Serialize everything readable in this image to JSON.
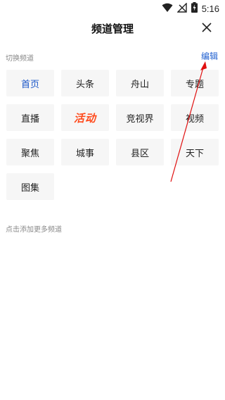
{
  "status_bar": {
    "time": "5:16",
    "icons": [
      "wifi-icon",
      "no-signal-icon",
      "battery-charging-icon"
    ]
  },
  "header": {
    "title": "频道管理",
    "close_icon": "close-icon"
  },
  "sections": {
    "switch_label": "切换频道",
    "edit_label": "编辑",
    "add_label": "点击添加更多频道"
  },
  "channels": [
    {
      "label": "首页",
      "state": "selected"
    },
    {
      "label": "头条"
    },
    {
      "label": "舟山"
    },
    {
      "label": "专题"
    },
    {
      "label": "直播"
    },
    {
      "label": "活动",
      "style": "promo-logo"
    },
    {
      "label": "竞视界"
    },
    {
      "label": "视频"
    },
    {
      "label": "聚焦"
    },
    {
      "label": "城事"
    },
    {
      "label": "县区"
    },
    {
      "label": "天下"
    },
    {
      "label": "图集"
    }
  ],
  "colors": {
    "accent": "#1a56c8",
    "edit_link": "#2060d0",
    "promo": "#ff4a1c",
    "annotation_arrow": "#e01010",
    "tile_bg": "#f6f6f6"
  }
}
